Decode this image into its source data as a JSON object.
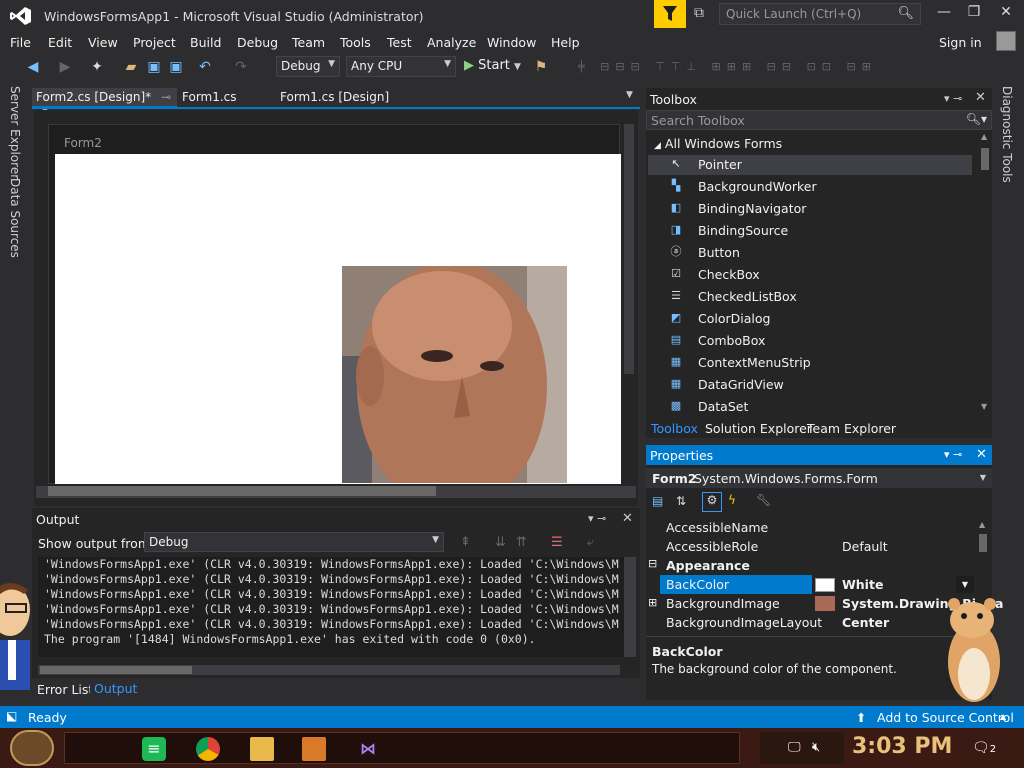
{
  "window": {
    "title": "WindowsFormsApp1 - Microsoft Visual Studio  (Administrator)",
    "quick_launch_placeholder": "Quick Launch (Ctrl+Q)"
  },
  "menu": [
    "File",
    "Edit",
    "View",
    "Project",
    "Build",
    "Debug",
    "Team",
    "Tools",
    "Test",
    "Analyze",
    "Window",
    "Help"
  ],
  "signin": "Sign in",
  "toolbar": {
    "config": "Debug",
    "platform": "Any CPU",
    "start_label": "Start"
  },
  "left_strip": [
    "Server Explorer",
    "Data Sources"
  ],
  "right_strip": "Diagnostic Tools",
  "doc_tabs": [
    "Form2.cs [Design]*",
    "Form1.cs",
    "Form1.cs [Design]"
  ],
  "designer": {
    "form_title": "Form2"
  },
  "output": {
    "title": "Output",
    "show_from_label": "Show output from:",
    "show_from_value": "Debug",
    "lines": [
      "'WindowsFormsApp1.exe' (CLR v4.0.30319: WindowsFormsApp1.exe): Loaded 'C:\\Windows\\M",
      "'WindowsFormsApp1.exe' (CLR v4.0.30319: WindowsFormsApp1.exe): Loaded 'C:\\Windows\\M",
      "'WindowsFormsApp1.exe' (CLR v4.0.30319: WindowsFormsApp1.exe): Loaded 'C:\\Windows\\M",
      "'WindowsFormsApp1.exe' (CLR v4.0.30319: WindowsFormsApp1.exe): Loaded 'C:\\Windows\\M",
      "'WindowsFormsApp1.exe' (CLR v4.0.30319: WindowsFormsApp1.exe): Loaded 'C:\\Windows\\M",
      "The program '[1484] WindowsFormsApp1.exe' has exited with code 0 (0x0)."
    ],
    "bottom_tabs": [
      "Error List",
      "Output"
    ]
  },
  "toolbox": {
    "title": "Toolbox",
    "search_placeholder": "Search Toolbox",
    "group": "All Windows Forms",
    "items": [
      "Pointer",
      "BackgroundWorker",
      "BindingNavigator",
      "BindingSource",
      "Button",
      "CheckBox",
      "CheckedListBox",
      "ColorDialog",
      "ComboBox",
      "ContextMenuStrip",
      "DataGridView",
      "DataSet"
    ],
    "tabs": [
      "Toolbox",
      "Solution Explorer",
      "Team Explorer"
    ]
  },
  "properties": {
    "title": "Properties",
    "object_name": "Form2",
    "object_type": "System.Windows.Forms.Form",
    "rows": [
      {
        "name": "AccessibleName",
        "value": ""
      },
      {
        "name": "AccessibleRole",
        "value": "Default"
      },
      {
        "name": "Appearance",
        "value": ""
      },
      {
        "name": "BackColor",
        "value": "White"
      },
      {
        "name": "BackgroundImage",
        "value": "System.Drawing.Bitma"
      },
      {
        "name": "BackgroundImageLayout",
        "value": "Center"
      }
    ],
    "desc_title": "BackColor",
    "desc_text": "The background color of the component."
  },
  "status": {
    "text": "Ready",
    "source_control": "Add to Source Control"
  },
  "taskbar": {
    "clock": "3:03 PM",
    "notif_count": "2"
  },
  "colors": {
    "accent": "#007acc",
    "filter": "#ffcc00"
  }
}
